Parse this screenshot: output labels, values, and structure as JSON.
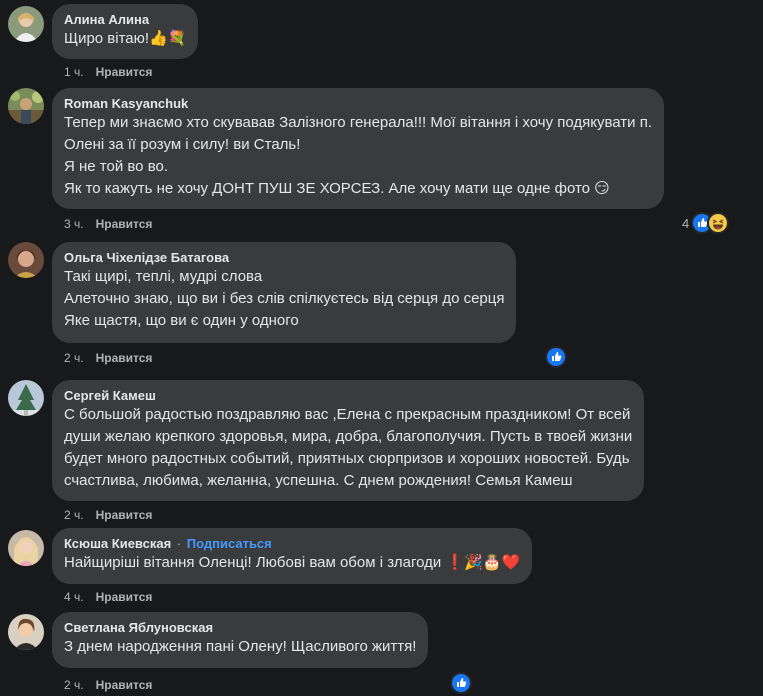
{
  "comments": [
    {
      "author": "Алина Алина",
      "lines": [
        "Щиро вітаю!👍💐"
      ],
      "time": "1 ч.",
      "like_label": "Нравится"
    },
    {
      "author": "Roman Kasyanchuk",
      "lines": [
        "Тепер ми знаємо хто скувавав Залізного генерала!!! Мої вітання і хочу подякувати п.",
        "Олені за її розум і силу! ви Сталь!",
        "Я не той во во.",
        "Як то кажуть не хочу ДОНТ ПУШ ЗЕ ХОРСЕЗ. Але хочу мати ще одне фото 😏"
      ],
      "time": "3 ч.",
      "like_label": "Нравится",
      "reaction_count": "4"
    },
    {
      "author": "Ольга Чіхелідзе Батагова",
      "lines": [
        "Такі щирі, теплі, мудрі слова",
        "Алеточно знаю, що ви і без слів спілкуєтесь від серця до серця",
        "Яке щастя, що ви є один у одного"
      ],
      "time": "2 ч.",
      "like_label": "Нравится"
    },
    {
      "author": "Сергей Камеш",
      "lines": [
        "С большой радостью поздравляю вас ,Елена с прекрасным праздником! От всей",
        "души желаю крепкого здоровья, мира, добра, благополучия. Пусть в твоей жизни",
        "будет много радостных событий, приятных сюрпризов и хороших новостей. Будь",
        "счастлива, любима, желанна, успешна. С днем рождения! Семья Камеш"
      ],
      "time": "2 ч.",
      "like_label": "Нравится"
    },
    {
      "author": "Ксюша Киевская",
      "separator": "·",
      "follow_label": "Подписаться",
      "lines": [
        "Найщиріші вітання Оленці! Любові вам обом і злагоди ❗🎉🎂❤️"
      ],
      "time": "4 ч.",
      "like_label": "Нравится"
    },
    {
      "author": "Светлана Яблуновская",
      "lines": [
        "З днем народження пані Олену! Щасливого життя!"
      ],
      "time": "2 ч.",
      "like_label": "Нравится"
    }
  ],
  "icons": {
    "like_reaction": "like-icon",
    "haha_reaction": "haha-icon"
  },
  "colors": {
    "background": "#18191a",
    "bubble": "#3a3b3c",
    "text": "#e4e6eb",
    "secondary": "#b0b3b8",
    "link": "#4599ff",
    "like_blue": "#1877f2"
  }
}
